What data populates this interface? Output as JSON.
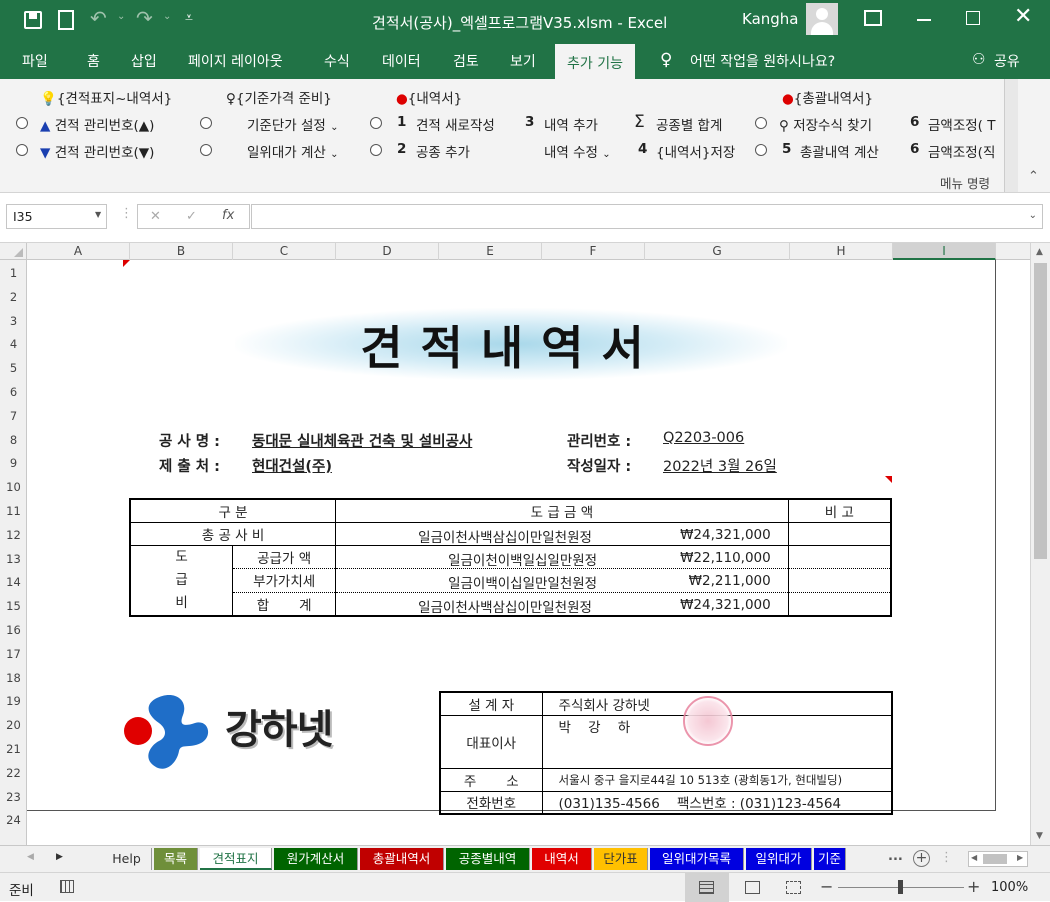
{
  "window": {
    "title": "견적서(공사)_엑셀프로그램V35.xlsm  -  Excel",
    "user": "Kangha"
  },
  "ribbon_tabs": [
    "파일",
    "홈",
    "삽입",
    "페이지 레이아웃",
    "수식",
    "데이터",
    "검토",
    "보기",
    "추가 기능"
  ],
  "tell_me": "어떤 작업을 원하시나요?",
  "share": "공유",
  "addins": {
    "headers": [
      "{견적표지~내역서}",
      "{기준가격 준비}",
      "{내역서}",
      "{총괄내역서}"
    ],
    "row1": [
      "견적 관리번호(▲)",
      "기준단가 설정",
      "1",
      "견적 새로작성",
      "3",
      "내역 추가",
      "공종별 합계",
      "저장수식 찾기",
      "6",
      "금액조정( T"
    ],
    "row2": [
      "견적 관리번호(▼)",
      "일위대가 계산",
      "2",
      "공종 추가",
      "내역 수정",
      "4",
      "{내역서}저장",
      "5",
      "총괄내역 계산",
      "6",
      "금액조정(직"
    ],
    "group_label": "메뉴 명령"
  },
  "namebox": "I35",
  "fx_symbols": {
    "cancel": "✕",
    "enter": "✓",
    "fx": "fx"
  },
  "columns": [
    "A",
    "B",
    "C",
    "D",
    "E",
    "F",
    "G",
    "H",
    "I"
  ],
  "rows": [
    "1",
    "2",
    "3",
    "4",
    "5",
    "6",
    "7",
    "8",
    "9",
    "10",
    "11",
    "12",
    "13",
    "14",
    "15",
    "16",
    "17",
    "18",
    "19",
    "20",
    "21",
    "22",
    "23",
    "24"
  ],
  "doc": {
    "title": "견적내역서",
    "project_label": "공 사 명 :",
    "project": "동대문 실내체육관 건축 및 설비공사",
    "client_label": "제 출 처 :",
    "client": "현대건설(주)",
    "mgmt_label": "관리번호 :",
    "mgmt_no": "Q2203-006",
    "date_label": "작성일자 :",
    "date": "2022년 3월 26일",
    "table": {
      "h_div": "구          분",
      "h_amount": "도          급          금          액",
      "h_note": "비     고",
      "total_label": "총 공 사 비",
      "total_words": "일금이천사백삼십이만일천원정",
      "total_amt": "₩24,321,000",
      "grp": [
        "도",
        "급",
        "비"
      ],
      "sub": [
        {
          "label": "공급가 액",
          "words": "일금이천이백일십일만원정",
          "amt": "₩22,110,000"
        },
        {
          "label": "부가가치세",
          "words": "일금이백이십일만일천원정",
          "amt": "₩2,211,000"
        },
        {
          "label": "합       계",
          "words": "일금이천사백삼십이만일천원정",
          "amt": "₩24,321,000"
        }
      ]
    },
    "logo_text": "강하넷",
    "company": [
      {
        "label": "설 계 자",
        "value": "주식회사 강하넷"
      },
      {
        "label": "대표이사",
        "value": "박    강    하"
      },
      {
        "label": "주       소",
        "value": "서울시 중구 을지로44길 10 513호 (광희동1가, 현대빌딩)"
      },
      {
        "label": "전화번호",
        "value": "(031)135-4566    팩스번호 : (031)123-4564"
      }
    ]
  },
  "sheet_tabs": [
    {
      "label": "Help",
      "color": "#f0f0f0",
      "text": "#333"
    },
    {
      "label": "목록",
      "color": "#6f8f3a",
      "text": "#fff"
    },
    {
      "label": "견적표지",
      "color": "#ffffff",
      "text": "#217346"
    },
    {
      "label": "원가계산서",
      "color": "#006400",
      "text": "#fff"
    },
    {
      "label": "총괄내역서",
      "color": "#c00000",
      "text": "#fff"
    },
    {
      "label": "공종별내역",
      "color": "#006400",
      "text": "#fff"
    },
    {
      "label": "내역서",
      "color": "#e00000",
      "text": "#fff"
    },
    {
      "label": "단가표",
      "color": "#ffc000",
      "text": "#333"
    },
    {
      "label": "일위대가목록",
      "color": "#0000e0",
      "text": "#fff"
    },
    {
      "label": "일위대가",
      "color": "#0000e0",
      "text": "#fff"
    },
    {
      "label": "기준",
      "color": "#0000e0",
      "text": "#fff"
    }
  ],
  "status": {
    "ready": "준비",
    "zoom": "100%",
    "more_tabs": "..."
  }
}
